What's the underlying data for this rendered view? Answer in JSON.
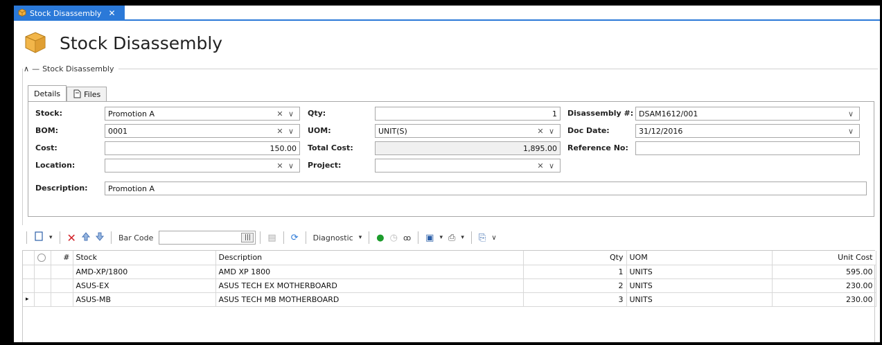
{
  "tab": {
    "label": "Stock Disassembly",
    "close": "✕"
  },
  "header": {
    "title": "Stock Disassembly"
  },
  "group": {
    "legend": "Stock Disassembly",
    "collapse": "∧"
  },
  "tabs": [
    {
      "label": "Details"
    },
    {
      "label": "Files"
    }
  ],
  "form": {
    "stock": {
      "label": "Stock:",
      "value": "Promotion A"
    },
    "bom": {
      "label": "BOM:",
      "value": "0001"
    },
    "cost": {
      "label": "Cost:",
      "value": "150.00"
    },
    "location": {
      "label": "Location:",
      "value": ""
    },
    "description": {
      "label": "Description:",
      "value": "Promotion A"
    },
    "qty": {
      "label": "Qty:",
      "value": "1"
    },
    "uom": {
      "label": "UOM:",
      "value": "UNIT(S)"
    },
    "total_cost": {
      "label": "Total Cost:",
      "value": "1,895.00"
    },
    "project": {
      "label": "Project:",
      "value": ""
    },
    "disassembly_no": {
      "label": "Disassembly #:",
      "value": "DSAM1612/001"
    },
    "doc_date": {
      "label": "Doc Date:",
      "value": "31/12/2016"
    },
    "reference_no": {
      "label": "Reference No:",
      "value": ""
    },
    "clear_glyph": "✕",
    "dropdown_glyph": "∨"
  },
  "toolbar": {
    "bar_code_label": "Bar Code",
    "bar_code_value": "",
    "diagnostic_label": "Diagnostic"
  },
  "grid": {
    "columns": {
      "num": "#",
      "stock": "Stock",
      "description": "Description",
      "qty": "Qty",
      "uom": "UOM",
      "unit_cost": "Unit Cost"
    },
    "rows": [
      {
        "stock": "AMD-XP/1800",
        "description": "AMD XP 1800",
        "qty": "1",
        "uom": "UNITS",
        "unit_cost": "595.00"
      },
      {
        "stock": "ASUS-EX",
        "description": "ASUS TECH EX MOTHERBOARD",
        "qty": "2",
        "uom": "UNITS",
        "unit_cost": "230.00"
      },
      {
        "stock": "ASUS-MB",
        "description": "ASUS TECH MB MOTHERBOARD",
        "qty": "3",
        "uom": "UNITS",
        "unit_cost": "230.00"
      }
    ],
    "current_row_marker": "▸"
  },
  "colors": {
    "accent": "#2b79d8",
    "box_icon": "#e8a838"
  }
}
